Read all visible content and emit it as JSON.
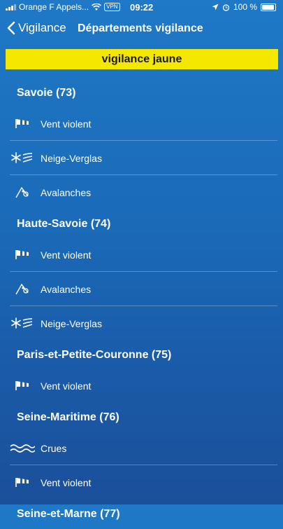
{
  "status_bar": {
    "carrier": "Orange F Appels...",
    "vpn": "VPN",
    "time": "09:22",
    "battery": "100 %"
  },
  "nav": {
    "back_label": "Vigilance",
    "title": "Départements vigilance"
  },
  "banner": {
    "label": "vigilance jaune",
    "color": "#f5e800"
  },
  "departments": [
    {
      "name": "Savoie (73)",
      "alerts": [
        "Vent violent",
        "Neige-Verglas",
        "Avalanches"
      ]
    },
    {
      "name": "Haute-Savoie (74)",
      "alerts": [
        "Vent violent",
        "Avalanches",
        "Neige-Verglas"
      ]
    },
    {
      "name": "Paris-et-Petite-Couronne (75)",
      "alerts": [
        "Vent violent"
      ]
    },
    {
      "name": "Seine-Maritime (76)",
      "alerts": [
        "Crues",
        "Vent violent"
      ]
    },
    {
      "name": "Seine-et-Marne (77)",
      "alerts": []
    }
  ],
  "icons": {
    "Vent violent": "wind-sock-icon",
    "Neige-Verglas": "snow-ice-icon",
    "Avalanches": "avalanche-icon",
    "Crues": "flood-waves-icon"
  }
}
